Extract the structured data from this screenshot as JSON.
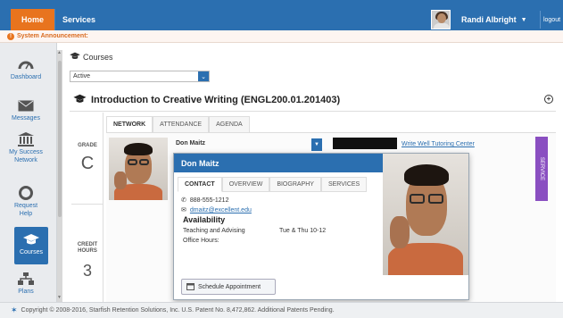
{
  "topbar": {
    "home_label": "Home",
    "services_label": "Services",
    "user_name": "Randi Albright",
    "logout_label": "logout"
  },
  "announcement": {
    "text": "System Announcement:"
  },
  "sidebar": {
    "items": [
      {
        "label": "Dashboard",
        "icon": "dashboard-icon"
      },
      {
        "label": "Messages",
        "icon": "envelope-icon"
      },
      {
        "label": "My Success Network",
        "icon": "institution-icon"
      },
      {
        "label": "Request Help",
        "icon": "lifebuoy-icon"
      },
      {
        "label": "Courses",
        "icon": "graduation-cap-icon",
        "active": true
      },
      {
        "label": "Plans",
        "icon": "sitemap-icon"
      }
    ]
  },
  "courses": {
    "header": "Courses",
    "status_value": "Active"
  },
  "course": {
    "title": "Introduction to Creative Writing (ENGL200.01.201403)",
    "grade_label": "GRADE",
    "grade_value": "C",
    "credit_label": "CREDIT HOURS",
    "credit_value": "3",
    "tabs": [
      "NETWORK",
      "ATTENDANCE",
      "AGENDA"
    ],
    "active_tab": "NETWORK"
  },
  "network": {
    "card_name": "Don Maitz",
    "second_card_link": "Write Well Tutoring Center",
    "service_label": "SERVICE"
  },
  "popup": {
    "name": "Don Maitz",
    "tabs": [
      "CONTACT",
      "OVERVIEW",
      "BIOGRAPHY",
      "SERVICES"
    ],
    "active_tab": "CONTACT",
    "phone": "888-555-1212",
    "email": "dmaitz@excellent.edu",
    "availability_title": "Availability",
    "teaching_label": "Teaching and Advising",
    "teaching_time": "Tue & Thu 10-12",
    "office_hours_label": "Office Hours:",
    "schedule_button": "Schedule Appointment"
  },
  "footer": {
    "text": "Copyright © 2008-2016, Starfish Retention Solutions, Inc. U.S. Patent No. 8,472,862. Additional Patents Pending."
  },
  "colors": {
    "brand_blue": "#2b6fb0",
    "home_orange": "#e8741e",
    "service_purple": "#8a4fc1"
  }
}
